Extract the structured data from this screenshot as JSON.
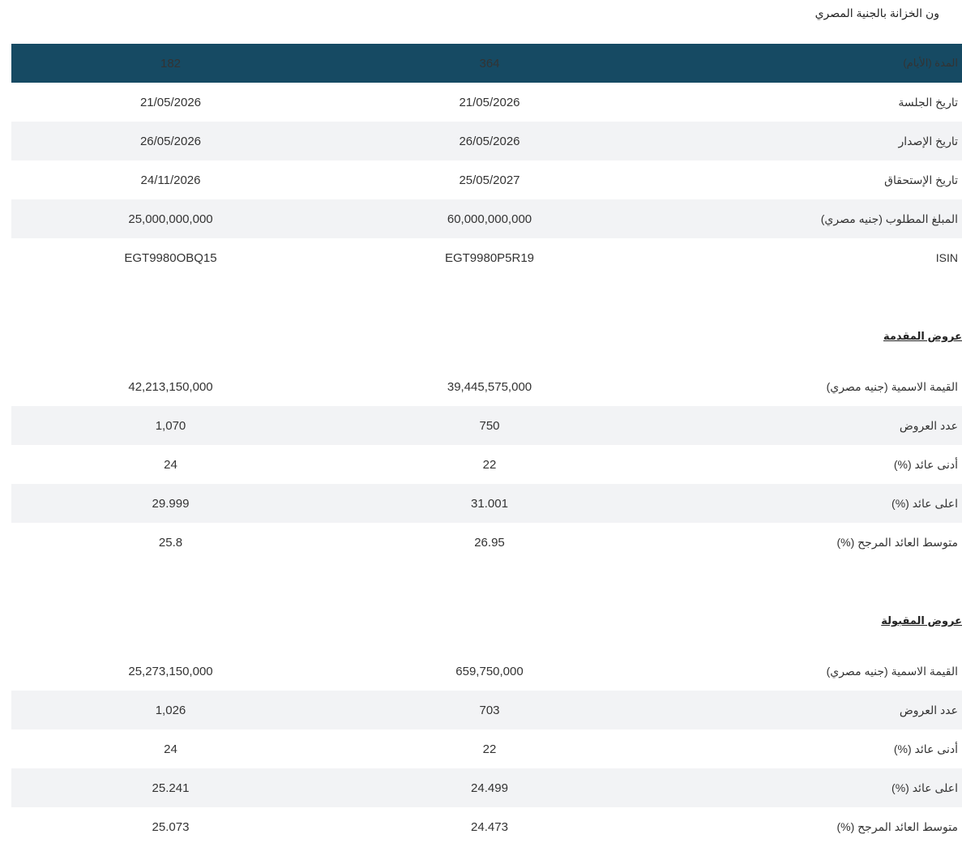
{
  "page_title": "ون الخزانة بالجنية المصري",
  "main_table": {
    "header": {
      "label": "المدة (الأيام)",
      "col_364": "364",
      "col_182": "182"
    },
    "rows": [
      {
        "label": "تاريخ الجلسة",
        "v364": "21/05/2026",
        "v182": "21/05/2026"
      },
      {
        "label": "تاريخ الإصدار",
        "v364": "26/05/2026",
        "v182": "26/05/2026"
      },
      {
        "label": "تاريخ الإستحقاق",
        "v364": "25/05/2027",
        "v182": "24/11/2026"
      },
      {
        "label": "المبلغ المطلوب (جنيه مصري)",
        "v364": "60,000,000,000",
        "v182": "25,000,000,000"
      },
      {
        "label": "ISIN",
        "v364": "EGT9980P5R19",
        "v182": "EGT9980OBQ15"
      }
    ]
  },
  "offers_section": {
    "heading": "عروض المقدمة",
    "rows": [
      {
        "label": "القيمة الاسمية (جنيه مصري)",
        "v364": "39,445,575,000",
        "v182": "42,213,150,000"
      },
      {
        "label": "عدد العروض",
        "v364": "750",
        "v182": "1,070"
      },
      {
        "label": "أدنى عائد (%)",
        "v364": "22",
        "v182": "24"
      },
      {
        "label": "اعلى عائد (%)",
        "v364": "31.001",
        "v182": "29.999"
      },
      {
        "label": "متوسط العائد المرجح (%)",
        "v364": "26.95",
        "v182": "25.8"
      }
    ]
  },
  "accepted_section": {
    "heading": "عروض المقبولة",
    "rows": [
      {
        "label": "القيمة الاسمية (جنيه مصري)",
        "v364": "659,750,000",
        "v182": "25,273,150,000"
      },
      {
        "label": "عدد العروض",
        "v364": "703",
        "v182": "1,026"
      },
      {
        "label": "أدنى عائد (%)",
        "v364": "22",
        "v182": "24"
      },
      {
        "label": "اعلى عائد (%)",
        "v364": "24.499",
        "v182": "25.241"
      },
      {
        "label": "متوسط العائد المرجح (%)",
        "v364": "24.473",
        "v182": "25.073"
      }
    ]
  }
}
